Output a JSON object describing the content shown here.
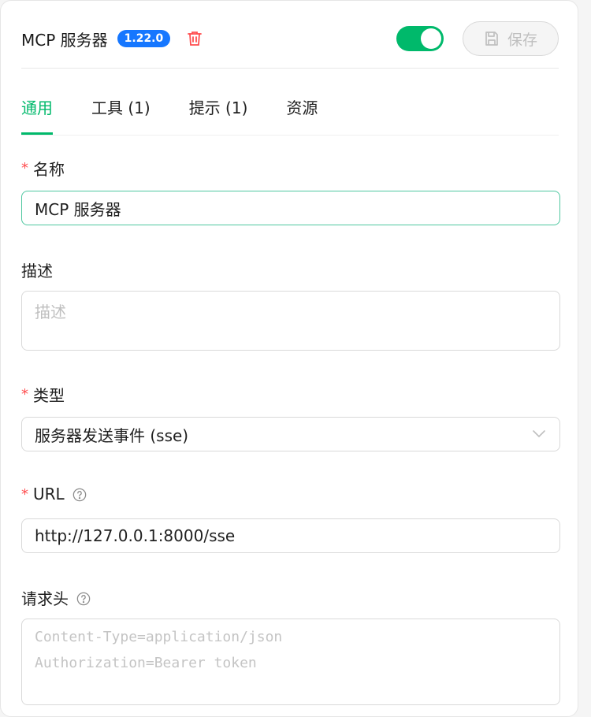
{
  "header": {
    "title": "MCP 服务器",
    "version": "1.22.0",
    "enabled": true,
    "save_label": "保存"
  },
  "tabs": [
    {
      "label": "通用",
      "active": true
    },
    {
      "label": "工具 (1)",
      "active": false
    },
    {
      "label": "提示 (1)",
      "active": false
    },
    {
      "label": "资源",
      "active": false
    }
  ],
  "form": {
    "name": {
      "label": "名称",
      "required": true,
      "value": "MCP 服务器"
    },
    "description": {
      "label": "描述",
      "required": false,
      "placeholder": "描述"
    },
    "type": {
      "label": "类型",
      "required": true,
      "value": "服务器发送事件 (sse)"
    },
    "url": {
      "label": "URL",
      "required": true,
      "value": "http://127.0.0.1:8000/sse"
    },
    "headers": {
      "label": "请求头",
      "placeholder_lines": [
        "Content-Type=application/json",
        "Authorization=Bearer token"
      ]
    }
  },
  "colors": {
    "accent": "#00b96b",
    "version_badge": "#1677ff",
    "required": "#ff4d4f",
    "delete": "#ff4d4f"
  },
  "icons": [
    "trash-icon",
    "save-icon",
    "help-icon",
    "chevron-down-icon"
  ]
}
